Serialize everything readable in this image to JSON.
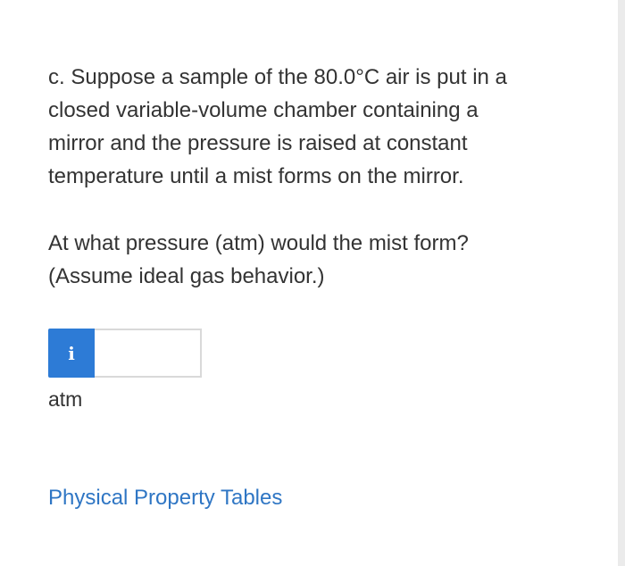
{
  "question": {
    "text": "c. Suppose a sample of the 80.0°C air is put in a\nclosed variable-volume chamber containing a\nmirror and the pressure is raised at constant\ntemperature until a mist forms on the mirror.",
    "prompt": "At what pressure (atm) would the mist form?\n(Assume ideal gas behavior.)"
  },
  "answer": {
    "info_label": "i",
    "value": "",
    "unit": "atm"
  },
  "links": {
    "tables_label": "Physical Property Tables"
  },
  "colors": {
    "accent": "#2d7bd6",
    "link": "#2f76c4",
    "text": "#333333"
  }
}
